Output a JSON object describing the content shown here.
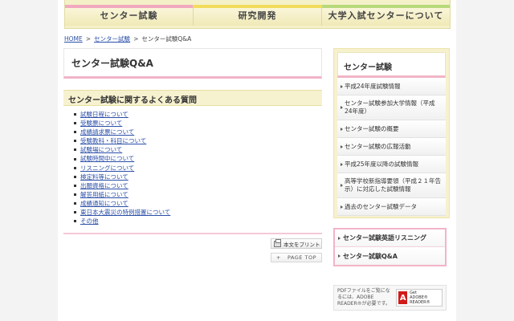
{
  "nav": {
    "tabs": [
      {
        "label": "センター試験"
      },
      {
        "label": "研究開発"
      },
      {
        "label": "大学入試センターについて"
      }
    ]
  },
  "breadcrumb": {
    "home": "HOME",
    "sep": ">",
    "center": "センター試験",
    "current": "センター試験Q&A"
  },
  "main": {
    "title": "センター試験Q&A",
    "section_title": "センター試験に関するよくある質問",
    "links": [
      "試験日程について",
      "受験票について",
      "成績請求票について",
      "受験教科・科目について",
      "試験場について",
      "試験時間中について",
      "リスニングについて",
      "検定料等について",
      "出願資格について",
      "解答用紙について",
      "成績通知について",
      "東日本大震災の特例措置について",
      "その他"
    ],
    "print_label": "本文をプリント",
    "pagetop_plus": "+",
    "pagetop_label": "PAGE TOP"
  },
  "sidebar": {
    "heading": "センター試験",
    "items": [
      "平成24年度試験情報",
      "センター試験参加大学情報（平成24年度）",
      "センター試験の概要",
      "センター試験の広報活動",
      "平成25年度以降の試験情報",
      "高等学校新指導要領（平成２１年告示）に対応した試験情報",
      "過去のセンター試験データ"
    ],
    "sub_items": [
      "センター試験英語リスニング",
      "センター試験Q&A"
    ],
    "pdf_note": "PDFファイルをご覧になるには、ADOBE READER®が必要です。",
    "adobe_get": "Get",
    "adobe_reader": "ADOBE® READER®",
    "adobe_letter": "A"
  }
}
